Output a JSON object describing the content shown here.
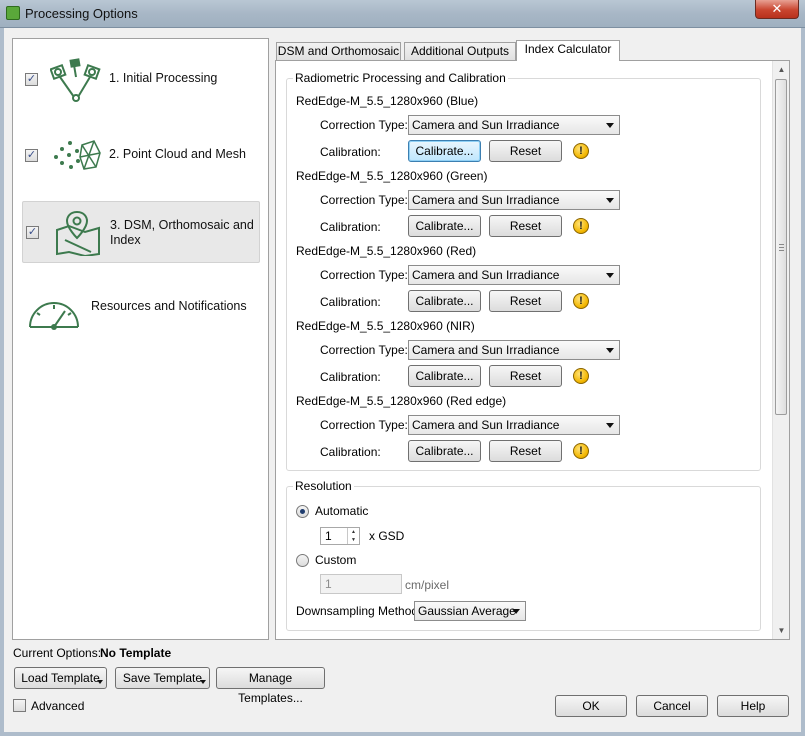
{
  "window": {
    "title": "Processing Options",
    "close_label": "✕"
  },
  "steps": [
    {
      "label": "1. Initial Processing",
      "checked": true,
      "icon": "initial-processing-icon"
    },
    {
      "label": "2. Point Cloud and Mesh",
      "checked": true,
      "icon": "point-cloud-icon"
    },
    {
      "label_line1": "3. DSM, Orthomosaic and",
      "label_line2": "Index",
      "checked": true,
      "icon": "map-pin-icon"
    },
    {
      "label": "Resources and Notifications",
      "icon": "gauge-icon"
    }
  ],
  "tabs": [
    "DSM and Orthomosaic",
    "Additional Outputs",
    "Index Calculator"
  ],
  "selected_tab": "Index Calculator",
  "radiometric": {
    "title": "Radiometric Processing and Calibration",
    "correction_label": "Correction Type:",
    "calibration_label": "Calibration:",
    "calibrate_label": "Calibrate...",
    "reset_label": "Reset",
    "warning_glyph": "!",
    "cameras": [
      {
        "name": "RedEdge-M_5.5_1280x960 (Blue)",
        "correction": "Camera and Sun Irradiance"
      },
      {
        "name": "RedEdge-M_5.5_1280x960 (Green)",
        "correction": "Camera and Sun Irradiance"
      },
      {
        "name": "RedEdge-M_5.5_1280x960 (Red)",
        "correction": "Camera and Sun Irradiance"
      },
      {
        "name": "RedEdge-M_5.5_1280x960 (NIR)",
        "correction": "Camera and Sun Irradiance"
      },
      {
        "name": "RedEdge-M_5.5_1280x960 (Red edge)",
        "correction": "Camera and Sun Irradiance"
      }
    ]
  },
  "resolution": {
    "title": "Resolution",
    "automatic_label": "Automatic",
    "automatic_selected": true,
    "gsd_value": "1",
    "gsd_unit": "x GSD",
    "custom_label": "Custom",
    "custom_value": "1",
    "custom_unit": "cm/pixel",
    "downsampling_label": "Downsampling Method:",
    "downsampling_value": "Gaussian Average"
  },
  "footer": {
    "current_options_label": "Current Options:",
    "current_options_value": "No Template",
    "load_template": "Load Template",
    "save_template": "Save Template",
    "manage_templates": "Manage Templates...",
    "advanced_label": "Advanced",
    "ok": "OK",
    "cancel": "Cancel",
    "help": "Help"
  },
  "colors": {
    "icon_green": "#3d7a4e",
    "titlebar": "#a8b7c6",
    "warning": "#f2b600"
  }
}
